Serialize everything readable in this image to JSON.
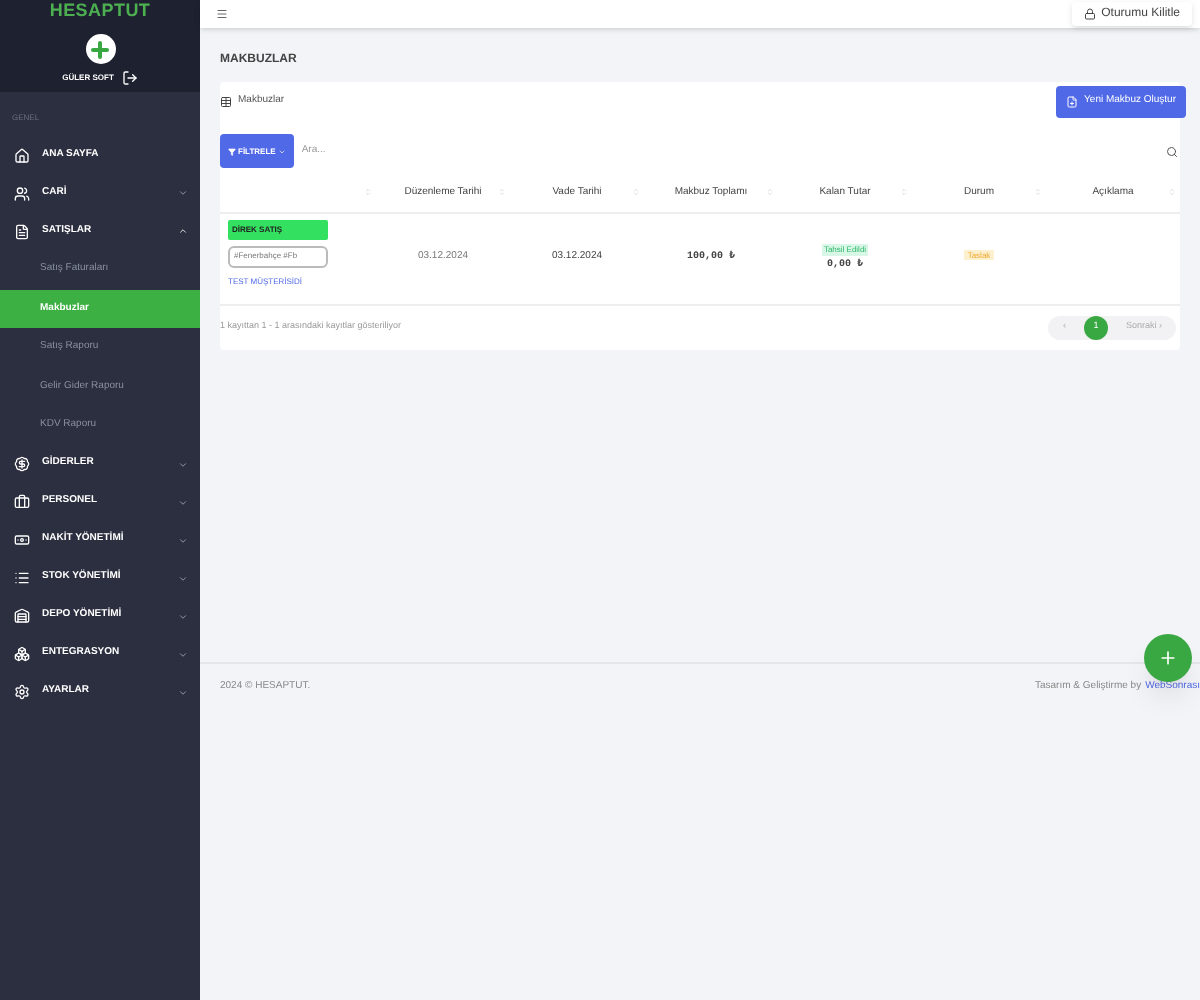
{
  "sidebar": {
    "logo": "HESAPTUT",
    "user": "GÜLER SOFT",
    "section": "GENEL",
    "items": [
      {
        "label": "ANA SAYFA"
      },
      {
        "label": "CARİ",
        "expanded": false
      },
      {
        "label": "SATIŞLAR",
        "expanded": true,
        "children": [
          {
            "label": "Satış Faturaları",
            "selected": false
          },
          {
            "label": "Makbuzlar",
            "selected": true
          },
          {
            "label": "Satış Raporu",
            "selected": false
          },
          {
            "label": "Gelir Gider Raporu",
            "selected": false
          },
          {
            "label": "KDV Raporu",
            "selected": false
          }
        ]
      },
      {
        "label": "GİDERLER",
        "expanded": false
      },
      {
        "label": "PERSONEL",
        "expanded": false
      },
      {
        "label": "NAKİT YÖNETİMİ",
        "expanded": false
      },
      {
        "label": "STOK YÖNETİMİ",
        "expanded": false
      },
      {
        "label": "DEPO YÖNETİMİ",
        "expanded": false
      },
      {
        "label": "ENTEGRASYON",
        "expanded": false
      },
      {
        "label": "AYARLAR",
        "expanded": false
      }
    ]
  },
  "topbar": {
    "lock_button": "Oturumu Kilitle"
  },
  "page_title": "MAKBUZLAR",
  "card": {
    "title": "Makbuzlar",
    "create_button": "Yeni Makbuz Oluştur",
    "filter_button": "FİLTRELE",
    "search": {
      "placeholder": "Ara..."
    }
  },
  "table": {
    "columns": [
      "Düzenleme Tarihi",
      "Vade Tarihi",
      "Makbuz Toplamı",
      "Kalan Tutar",
      "Durum",
      "Açıklama"
    ],
    "rows": [
      {
        "type_badge": "DİREK SATIŞ",
        "tags": "#Fenerbahçe #Fb",
        "customer": "TEST MÜŞTERİSİDİ",
        "issue_date": "03.12.2024",
        "due_date": "03.12.2024",
        "total": "100,00 ₺",
        "payment_badge": "Tahsil Edildi",
        "remaining": "0,00 ₺",
        "status": "Taslak"
      }
    ]
  },
  "table_info": "1 kayıttan 1 - 1 arasındaki kayıtlar gösteriliyor",
  "pagination": {
    "prev": "‹",
    "pages": [
      {
        "label": "1",
        "selected": true
      }
    ],
    "next": "Sonraki ›"
  },
  "footer": {
    "copyright": "2024 © HESAPTUT.",
    "credit": "Tasarım & Geliştirme by",
    "credit_link": "WebSonrası"
  }
}
